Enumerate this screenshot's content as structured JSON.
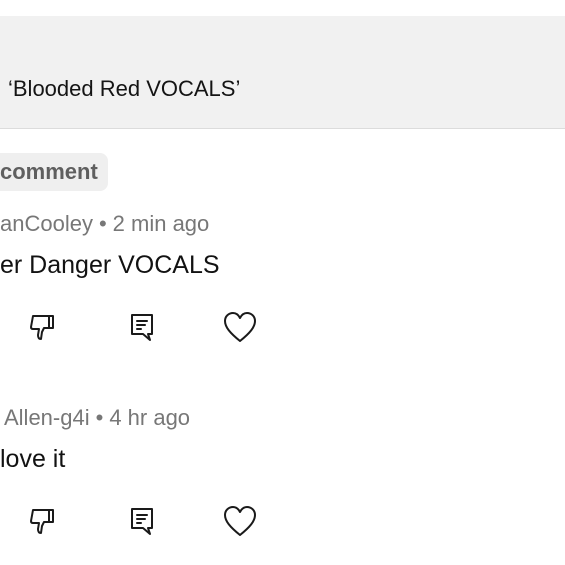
{
  "banner": {
    "text": "‘Blooded Red VOCALS’"
  },
  "comments_section": {
    "chip_label": "comment"
  },
  "comments": [
    {
      "author": "anCooley",
      "separator": "•",
      "time": "2 min ago",
      "text": "er Danger VOCALS"
    },
    {
      "author": "Allen-g4i",
      "separator": "•",
      "time": "4 hr ago",
      "text": "love it"
    }
  ],
  "icons": {
    "dislike": "thumbs-down-icon",
    "reply": "reply-comment-icon",
    "like": "heart-icon"
  },
  "colors": {
    "banner_bg": "#f1f1f1",
    "meta_text": "#777777",
    "body_text": "#121212",
    "icon_stroke": "#1a1a1a"
  }
}
